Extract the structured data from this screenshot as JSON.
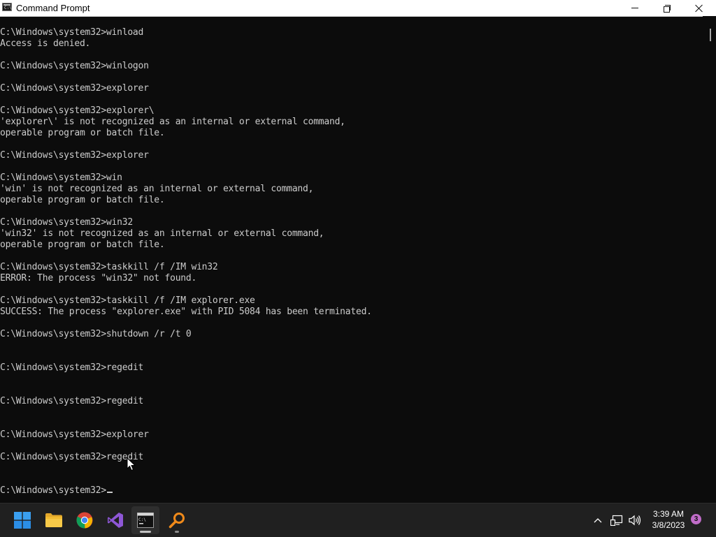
{
  "window": {
    "title": "Command Prompt",
    "icon_glyph": "C:\\"
  },
  "console": {
    "lines": [
      "C:\\Windows\\system32>winload",
      "Access is denied.",
      "",
      "C:\\Windows\\system32>winlogon",
      "",
      "C:\\Windows\\system32>explorer",
      "",
      "C:\\Windows\\system32>explorer\\",
      "'explorer\\' is not recognized as an internal or external command,",
      "operable program or batch file.",
      "",
      "C:\\Windows\\system32>explorer",
      "",
      "C:\\Windows\\system32>win",
      "'win' is not recognized as an internal or external command,",
      "operable program or batch file.",
      "",
      "C:\\Windows\\system32>win32",
      "'win32' is not recognized as an internal or external command,",
      "operable program or batch file.",
      "",
      "C:\\Windows\\system32>taskkill /f /IM win32",
      "ERROR: The process \"win32\" not found.",
      "",
      "C:\\Windows\\system32>taskkill /f /IM explorer.exe",
      "SUCCESS: The process \"explorer.exe\" with PID 5084 has been terminated.",
      "",
      "C:\\Windows\\system32>shutdown /r /t 0",
      "",
      "",
      "C:\\Windows\\system32>regedit",
      "",
      "",
      "C:\\Windows\\system32>regedit",
      "",
      "",
      "C:\\Windows\\system32>explorer",
      "",
      "C:\\Windows\\system32>regedit",
      "",
      "",
      "C:\\Windows\\system32>"
    ]
  },
  "taskbar": {
    "apps": [
      {
        "name": "start-button",
        "icon": "windows-logo-icon",
        "active": false
      },
      {
        "name": "file-explorer",
        "icon": "folder-icon",
        "active": false
      },
      {
        "name": "google-chrome",
        "icon": "chrome-icon",
        "active": false
      },
      {
        "name": "visual-studio",
        "icon": "visual-studio-icon",
        "active": false
      },
      {
        "name": "command-prompt",
        "icon": "terminal-icon",
        "active": true
      },
      {
        "name": "search-app",
        "icon": "magnifier-icon",
        "active": false
      }
    ],
    "clock": {
      "time": "3:39 AM",
      "date": "3/8/2023"
    },
    "notification_count": "3"
  },
  "colors": {
    "console_bg": "#0c0c0c",
    "console_fg": "#cccccc",
    "taskbar_bg": "#202020",
    "badge": "#c06cc8"
  }
}
